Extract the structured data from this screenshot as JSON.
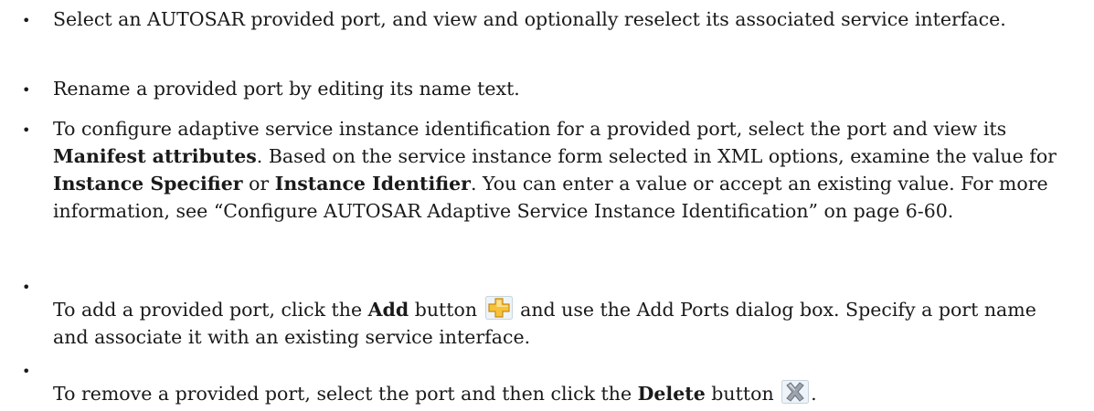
{
  "bullets": [
    {
      "text": "Select an AUTOSAR provided port, and view and optionally reselect its associated service interface."
    },
    {
      "text": "Rename a provided port by editing its name text."
    },
    {
      "t1": "To configure adaptive service instance identification for a provided port, select the port and view its ",
      "b1": "Manifest attributes",
      "t2": ". Based on the service instance form selected in XML options, examine the value for ",
      "b2": "Instance Specifier",
      "t3": " or ",
      "b3": "Instance Identifier",
      "t4": ". You can enter a value or accept an existing value. For more information, see “Configure AUTOSAR Adaptive Service Instance Identification” on page 6-60."
    },
    {
      "t1": "To add a provided port, click the ",
      "b1": "Add",
      "t2": " button ",
      "icon": "add-icon",
      "t3": " and use the Add Ports dialog box. Specify a port name and associate it with an existing service interface."
    },
    {
      "t1": "To remove a provided port, select the port and then click the ",
      "b1": "Delete",
      "t2": " button ",
      "icon": "delete-icon",
      "t3": "."
    }
  ],
  "bullet_char": "•",
  "colors": {
    "text": "#1a1a1a",
    "add_icon": "#f7c23a",
    "delete_icon": "#9ca3ab"
  }
}
